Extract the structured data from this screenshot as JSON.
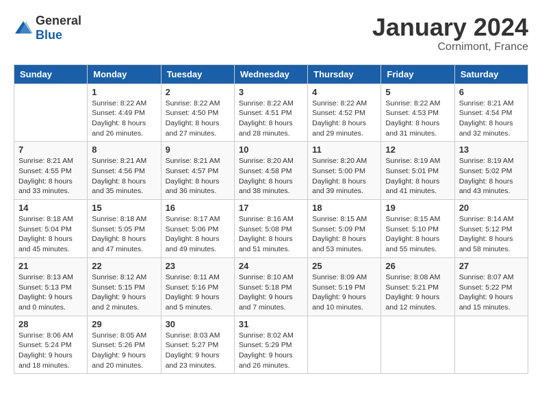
{
  "header": {
    "logo_general": "General",
    "logo_blue": "Blue",
    "month_title": "January 2024",
    "location": "Cornimont, France"
  },
  "columns": [
    "Sunday",
    "Monday",
    "Tuesday",
    "Wednesday",
    "Thursday",
    "Friday",
    "Saturday"
  ],
  "weeks": [
    [
      {
        "day": "",
        "info": ""
      },
      {
        "day": "1",
        "info": "Sunrise: 8:22 AM\nSunset: 4:49 PM\nDaylight: 8 hours\nand 26 minutes."
      },
      {
        "day": "2",
        "info": "Sunrise: 8:22 AM\nSunset: 4:50 PM\nDaylight: 8 hours\nand 27 minutes."
      },
      {
        "day": "3",
        "info": "Sunrise: 8:22 AM\nSunset: 4:51 PM\nDaylight: 8 hours\nand 28 minutes."
      },
      {
        "day": "4",
        "info": "Sunrise: 8:22 AM\nSunset: 4:52 PM\nDaylight: 8 hours\nand 29 minutes."
      },
      {
        "day": "5",
        "info": "Sunrise: 8:22 AM\nSunset: 4:53 PM\nDaylight: 8 hours\nand 31 minutes."
      },
      {
        "day": "6",
        "info": "Sunrise: 8:21 AM\nSunset: 4:54 PM\nDaylight: 8 hours\nand 32 minutes."
      }
    ],
    [
      {
        "day": "7",
        "info": "Sunrise: 8:21 AM\nSunset: 4:55 PM\nDaylight: 8 hours\nand 33 minutes."
      },
      {
        "day": "8",
        "info": "Sunrise: 8:21 AM\nSunset: 4:56 PM\nDaylight: 8 hours\nand 35 minutes."
      },
      {
        "day": "9",
        "info": "Sunrise: 8:21 AM\nSunset: 4:57 PM\nDaylight: 8 hours\nand 36 minutes."
      },
      {
        "day": "10",
        "info": "Sunrise: 8:20 AM\nSunset: 4:58 PM\nDaylight: 8 hours\nand 38 minutes."
      },
      {
        "day": "11",
        "info": "Sunrise: 8:20 AM\nSunset: 5:00 PM\nDaylight: 8 hours\nand 39 minutes."
      },
      {
        "day": "12",
        "info": "Sunrise: 8:19 AM\nSunset: 5:01 PM\nDaylight: 8 hours\nand 41 minutes."
      },
      {
        "day": "13",
        "info": "Sunrise: 8:19 AM\nSunset: 5:02 PM\nDaylight: 8 hours\nand 43 minutes."
      }
    ],
    [
      {
        "day": "14",
        "info": "Sunrise: 8:18 AM\nSunset: 5:04 PM\nDaylight: 8 hours\nand 45 minutes."
      },
      {
        "day": "15",
        "info": "Sunrise: 8:18 AM\nSunset: 5:05 PM\nDaylight: 8 hours\nand 47 minutes."
      },
      {
        "day": "16",
        "info": "Sunrise: 8:17 AM\nSunset: 5:06 PM\nDaylight: 8 hours\nand 49 minutes."
      },
      {
        "day": "17",
        "info": "Sunrise: 8:16 AM\nSunset: 5:08 PM\nDaylight: 8 hours\nand 51 minutes."
      },
      {
        "day": "18",
        "info": "Sunrise: 8:15 AM\nSunset: 5:09 PM\nDaylight: 8 hours\nand 53 minutes."
      },
      {
        "day": "19",
        "info": "Sunrise: 8:15 AM\nSunset: 5:10 PM\nDaylight: 8 hours\nand 55 minutes."
      },
      {
        "day": "20",
        "info": "Sunrise: 8:14 AM\nSunset: 5:12 PM\nDaylight: 8 hours\nand 58 minutes."
      }
    ],
    [
      {
        "day": "21",
        "info": "Sunrise: 8:13 AM\nSunset: 5:13 PM\nDaylight: 9 hours\nand 0 minutes."
      },
      {
        "day": "22",
        "info": "Sunrise: 8:12 AM\nSunset: 5:15 PM\nDaylight: 9 hours\nand 2 minutes."
      },
      {
        "day": "23",
        "info": "Sunrise: 8:11 AM\nSunset: 5:16 PM\nDaylight: 9 hours\nand 5 minutes."
      },
      {
        "day": "24",
        "info": "Sunrise: 8:10 AM\nSunset: 5:18 PM\nDaylight: 9 hours\nand 7 minutes."
      },
      {
        "day": "25",
        "info": "Sunrise: 8:09 AM\nSunset: 5:19 PM\nDaylight: 9 hours\nand 10 minutes."
      },
      {
        "day": "26",
        "info": "Sunrise: 8:08 AM\nSunset: 5:21 PM\nDaylight: 9 hours\nand 12 minutes."
      },
      {
        "day": "27",
        "info": "Sunrise: 8:07 AM\nSunset: 5:22 PM\nDaylight: 9 hours\nand 15 minutes."
      }
    ],
    [
      {
        "day": "28",
        "info": "Sunrise: 8:06 AM\nSunset: 5:24 PM\nDaylight: 9 hours\nand 18 minutes."
      },
      {
        "day": "29",
        "info": "Sunrise: 8:05 AM\nSunset: 5:26 PM\nDaylight: 9 hours\nand 20 minutes."
      },
      {
        "day": "30",
        "info": "Sunrise: 8:03 AM\nSunset: 5:27 PM\nDaylight: 9 hours\nand 23 minutes."
      },
      {
        "day": "31",
        "info": "Sunrise: 8:02 AM\nSunset: 5:29 PM\nDaylight: 9 hours\nand 26 minutes."
      },
      {
        "day": "",
        "info": ""
      },
      {
        "day": "",
        "info": ""
      },
      {
        "day": "",
        "info": ""
      }
    ]
  ]
}
